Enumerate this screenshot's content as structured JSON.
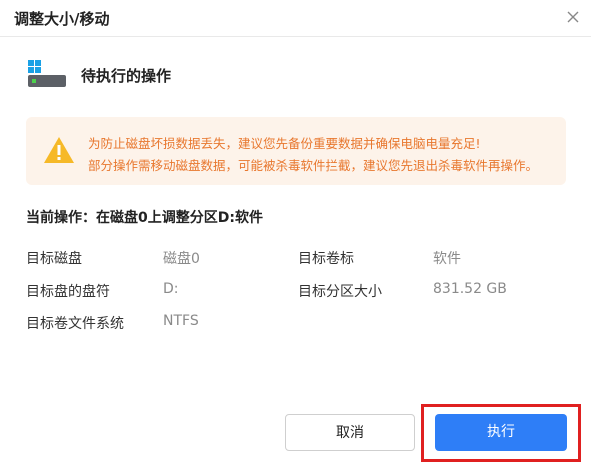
{
  "window": {
    "title": "调整大小/移动",
    "close_icon": "close-icon"
  },
  "operation": {
    "header": "待执行的操作",
    "icon": "windows-disk-icon"
  },
  "warning": {
    "icon": "warning-triangle-icon",
    "line1": "为防止磁盘坏损数据丢失，建议您先备份重要数据并确保电脑电量充足!",
    "line2": "部分操作需移动磁盘数据，可能被杀毒软件拦截，建议您先退出杀毒软件再操作。"
  },
  "current_operation": "当前操作：在磁盘0上调整分区D:软件",
  "info": {
    "target_disk_label": "目标磁盘",
    "target_disk_value": "磁盘0",
    "target_volume_label": "目标卷标",
    "target_volume_value": "软件",
    "drive_letter_label": "目标盘的盘符",
    "drive_letter_value": "D:",
    "partition_size_label": "目标分区大小",
    "partition_size_value": "831.52 GB",
    "filesystem_label": "目标卷文件系统",
    "filesystem_value": "NTFS"
  },
  "buttons": {
    "cancel": "取消",
    "execute": "执行"
  },
  "colors": {
    "accent": "#2e7ef7",
    "warning_text": "#e8772e",
    "warning_bg": "#fdf3ea",
    "highlight": "#e02020"
  }
}
